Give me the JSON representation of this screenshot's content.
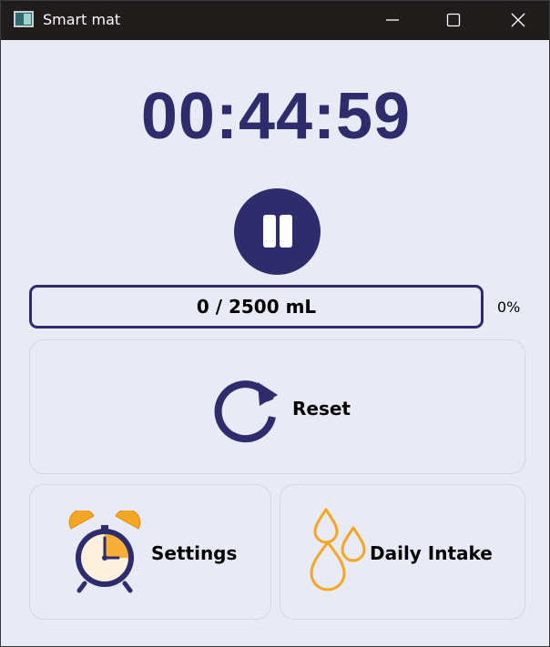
{
  "window": {
    "title": "Smart mat"
  },
  "timer": {
    "display": "00:44:59"
  },
  "pause_button": {
    "icon": "pause-icon"
  },
  "progress": {
    "label": "0 / 2500 mL",
    "percent_label": "0%",
    "fraction": 0.0
  },
  "buttons": {
    "reset": {
      "label": "Reset",
      "icon": "reset-icon"
    },
    "settings": {
      "label": "Settings",
      "icon": "alarm-clock-icon"
    },
    "daily_intake": {
      "label": "Daily Intake",
      "icon": "water-drops-icon"
    }
  },
  "colors": {
    "primary": "#2e2c6c",
    "background": "#e8eaf6",
    "titlebar": "#201c1b",
    "accent_orange": "#f5a623"
  }
}
